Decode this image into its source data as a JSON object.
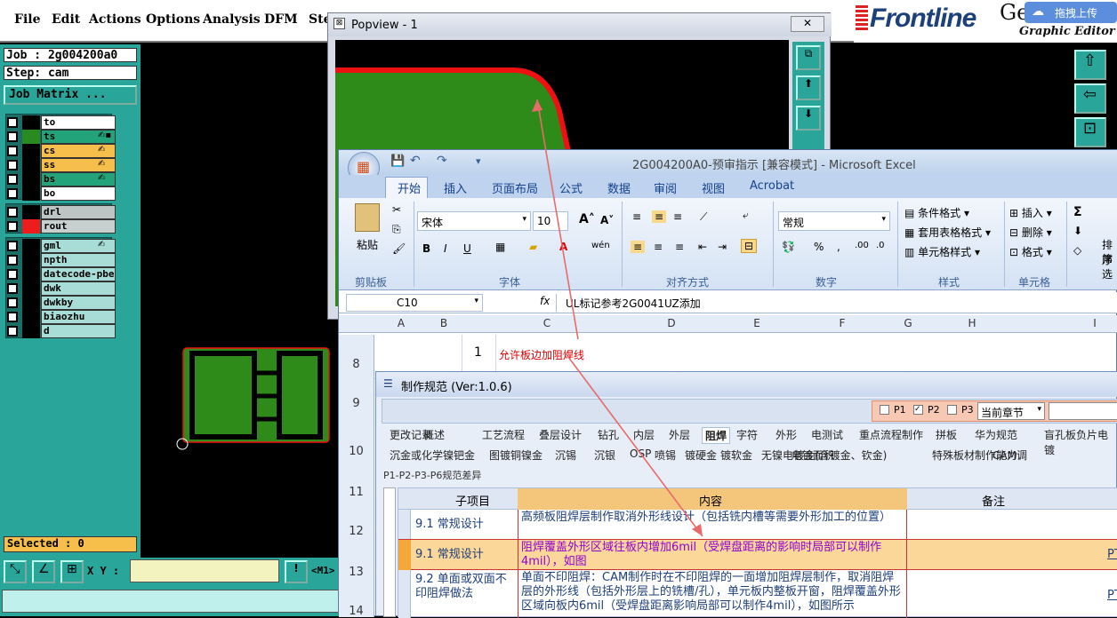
{
  "genesis": {
    "menu": [
      "File",
      "Edit",
      "Actions",
      "Options",
      "Analysis",
      "DFM",
      "Ste"
    ],
    "brand": "Frontline",
    "brand_ge": "Ge",
    "graphic_editor": "Graphic Editor",
    "upload": "拖拽上传",
    "job": "Job : 2g004200a0",
    "step": "Step: cam",
    "job_matrix": "Job Matrix ...",
    "layers": [
      {
        "name": "to",
        "sw": "#000000",
        "bg": "#ffffff",
        "mark": ""
      },
      {
        "name": "ts",
        "sw": "#2a8a22",
        "bg": "#22a37a",
        "mark": "✍▪"
      },
      {
        "name": "cs",
        "sw": "#000000",
        "bg": "#f6be4a",
        "mark": "✍"
      },
      {
        "name": "ss",
        "sw": "#000000",
        "bg": "#f6be4a",
        "mark": "✍"
      },
      {
        "name": "bs",
        "sw": "#000000",
        "bg": "#22a37a",
        "mark": "✍"
      },
      {
        "name": "bo",
        "sw": "#000000",
        "bg": "#ffffff",
        "mark": ""
      },
      {
        "name": "drl",
        "sw": "#000000",
        "bg": "#bcc4c4",
        "mark": ""
      },
      {
        "name": "rout",
        "sw": "#ee1c1c",
        "bg": "#c8cfcf",
        "mark": ""
      },
      {
        "name": "gml",
        "sw": "#000000",
        "bg": "#a8dcd6",
        "mark": "✍"
      },
      {
        "name": "npth",
        "sw": "#000000",
        "bg": "#a8dcd6",
        "mark": ""
      },
      {
        "name": "datecode-pbe",
        "sw": "#000000",
        "bg": "#a8dcd6",
        "mark": ""
      },
      {
        "name": "dwk",
        "sw": "#000000",
        "bg": "#a8dcd6",
        "mark": ""
      },
      {
        "name": "dwkby",
        "sw": "#000000",
        "bg": "#a8dcd6",
        "mark": ""
      },
      {
        "name": "biaozhu",
        "sw": "#000000",
        "bg": "#a8dcd6",
        "mark": ""
      },
      {
        "name": "d",
        "sw": "#000000",
        "bg": "#a8dcd6",
        "mark": ""
      }
    ],
    "selected": "Selected : 0",
    "xy_label": "X Y :",
    "m1": "<M1>",
    "excl": "!"
  },
  "popview": {
    "title": "Popview - 1"
  },
  "excel": {
    "title": "2G004200A0-预审指示 [兼容模式] - Microsoft Excel",
    "tabs": [
      "开始",
      "插入",
      "页面布局",
      "公式",
      "数据",
      "审阅",
      "视图",
      "Acrobat"
    ],
    "groups": [
      "剪贴板",
      "字体",
      "对齐方式",
      "数字",
      "样式",
      "单元格"
    ],
    "paste": "粘贴",
    "font": "宋体",
    "size": "10",
    "numfmt": "常规",
    "styles": [
      "条件格式 ▾",
      "套用表格格式 ▾",
      "单元格样式 ▾"
    ],
    "cells": [
      "插入 ▾",
      "删除 ▾",
      "格式 ▾"
    ],
    "sort": "排序",
    "filter": "筛选",
    "namebox": "C10",
    "formula": "UL标记参考2G0041UZ添加",
    "cols": [
      "A",
      "B",
      "C",
      "D",
      "E",
      "F",
      "G",
      "H",
      "I"
    ],
    "rows": [
      "8",
      "9",
      "10",
      "11",
      "12",
      "13",
      "14"
    ],
    "b8": "1",
    "c8": "允许板边加阻焊线"
  },
  "spec": {
    "title": "制作规范 (Ver:1.0.6)",
    "p1": "P1",
    "p2": "P2",
    "p3": "P3",
    "chapter": "当前章节",
    "tabs1": [
      "更改记录",
      "概述",
      "工艺流程",
      "叠层设计",
      "钻孔",
      "内层",
      "外层",
      "阻焊",
      "字符",
      "外形",
      "电测试",
      "重点流程制作",
      "拼板",
      "华为规范",
      "盲孔板负片电镀"
    ],
    "tabs2": [
      "沉金或化学镍钯金",
      "图镀铜镍金",
      "沉锡",
      "沉银",
      "OSP",
      "喷锡",
      "镀硬金",
      "镀软金",
      "无镍电镀金(含镀金、钦金)",
      "电镀面积",
      "特殊板材制作能力",
      "CAM调"
    ],
    "tab3": "P1-P2-P3-P6规范差异",
    "headers": [
      "子项目",
      "内容",
      "备注"
    ],
    "rows": [
      {
        "sub": "9.1 常规设计",
        "content": "高频板阻焊层制作取消外形线设计（包括铣内槽等需要外形加工的位置）",
        "note": "",
        "link": ""
      },
      {
        "sub": "9.1 常规设计",
        "content": "阻焊覆盖外形区域往板内增加6mil（受焊盘距离的影响时局部可以制作4mil），如图",
        "note": "",
        "link": "PTFE"
      },
      {
        "sub": "9.2 单面或双面不印阻焊做法",
        "content": "单面不印阻焊：CAM制作时在不印阻焊的一面增加阻焊层制作，取消阻焊层的外形线（包括外形层上的铣槽/孔），单元板内整板开窗，阻焊覆盖外形区域向板内6mil（受焊盘距离影响局部可以制作4mil），如图所示",
        "note": "",
        "link": "PTFE"
      }
    ]
  },
  "colors": {
    "teal": "#2aa59a",
    "green": "#2e8b1a",
    "red": "#ee1111",
    "accent": "#1d3f7a"
  }
}
